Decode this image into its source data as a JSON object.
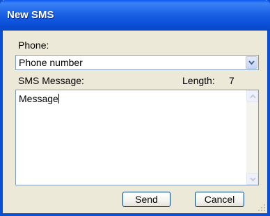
{
  "window": {
    "title": "New SMS"
  },
  "form": {
    "phone_label": "Phone:",
    "phone_value": "Phone number",
    "message_label": "SMS Message:",
    "length_label": "Length:",
    "length_value": "7",
    "message_text": "Message"
  },
  "buttons": {
    "send": "Send",
    "cancel": "Cancel"
  },
  "colors": {
    "title_bar": "#0a4fd6",
    "dialog_bg": "#ece9d8",
    "input_border": "#7f9db9"
  },
  "icons": {
    "combo": "chevron-down-icon",
    "scroll_up": "scroll-up-arrow-icon",
    "scroll_down": "scroll-down-arrow-icon",
    "grip": "resize-grip-icon"
  }
}
